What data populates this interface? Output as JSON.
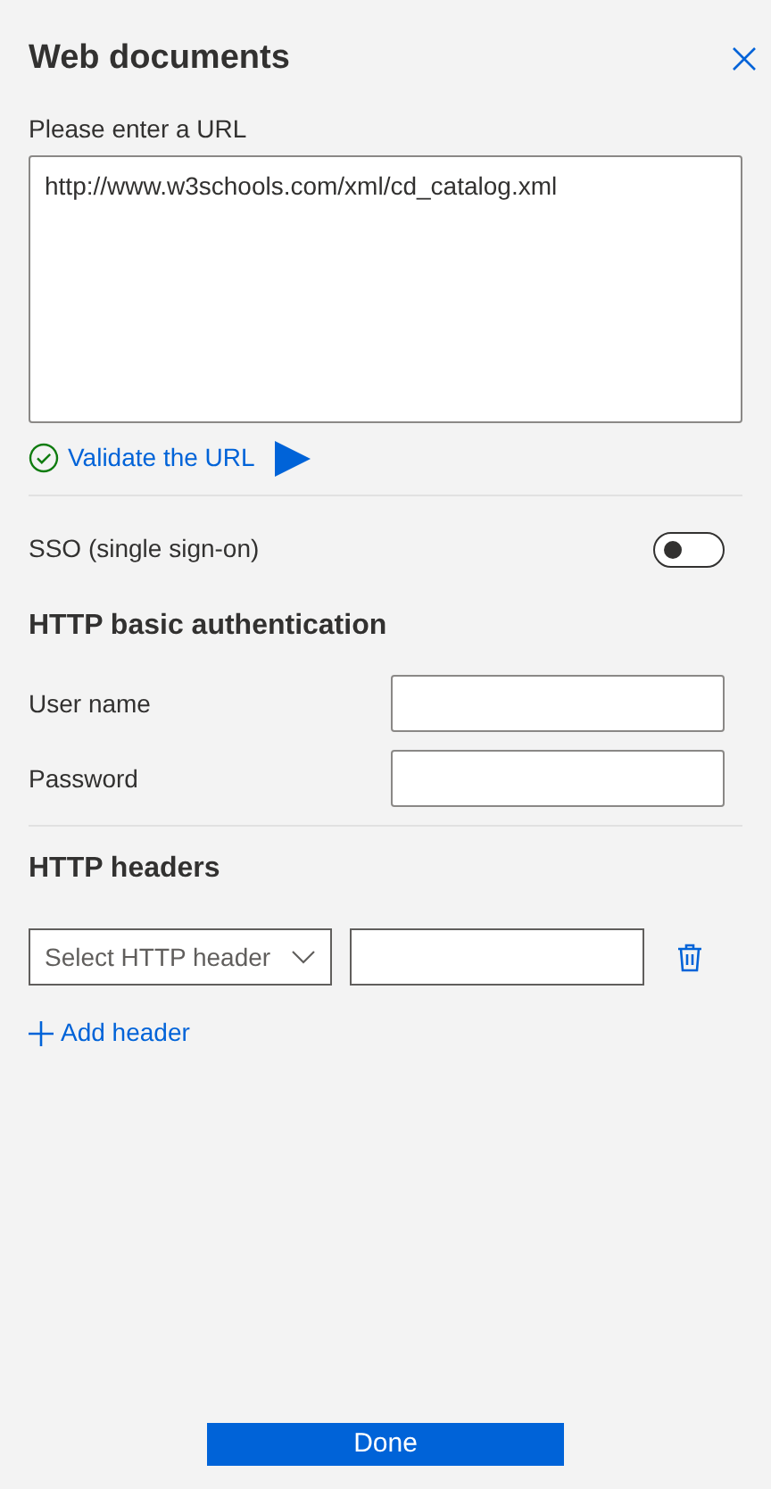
{
  "title": "Web documents",
  "url": {
    "label": "Please enter a URL",
    "value": "http://www.w3schools.com/xml/cd_catalog.xml"
  },
  "validate": {
    "label": "Validate the URL"
  },
  "sso": {
    "label": "SSO (single sign-on)",
    "on": false
  },
  "basic_auth": {
    "heading": "HTTP basic authentication",
    "fields": [
      {
        "label": "User name"
      },
      {
        "label": "Password"
      }
    ]
  },
  "headers": {
    "heading": "HTTP headers",
    "rows": [
      {
        "placeholder": "Select HTTP header"
      }
    ],
    "add_label": "Add header"
  },
  "done_button": "Done"
}
